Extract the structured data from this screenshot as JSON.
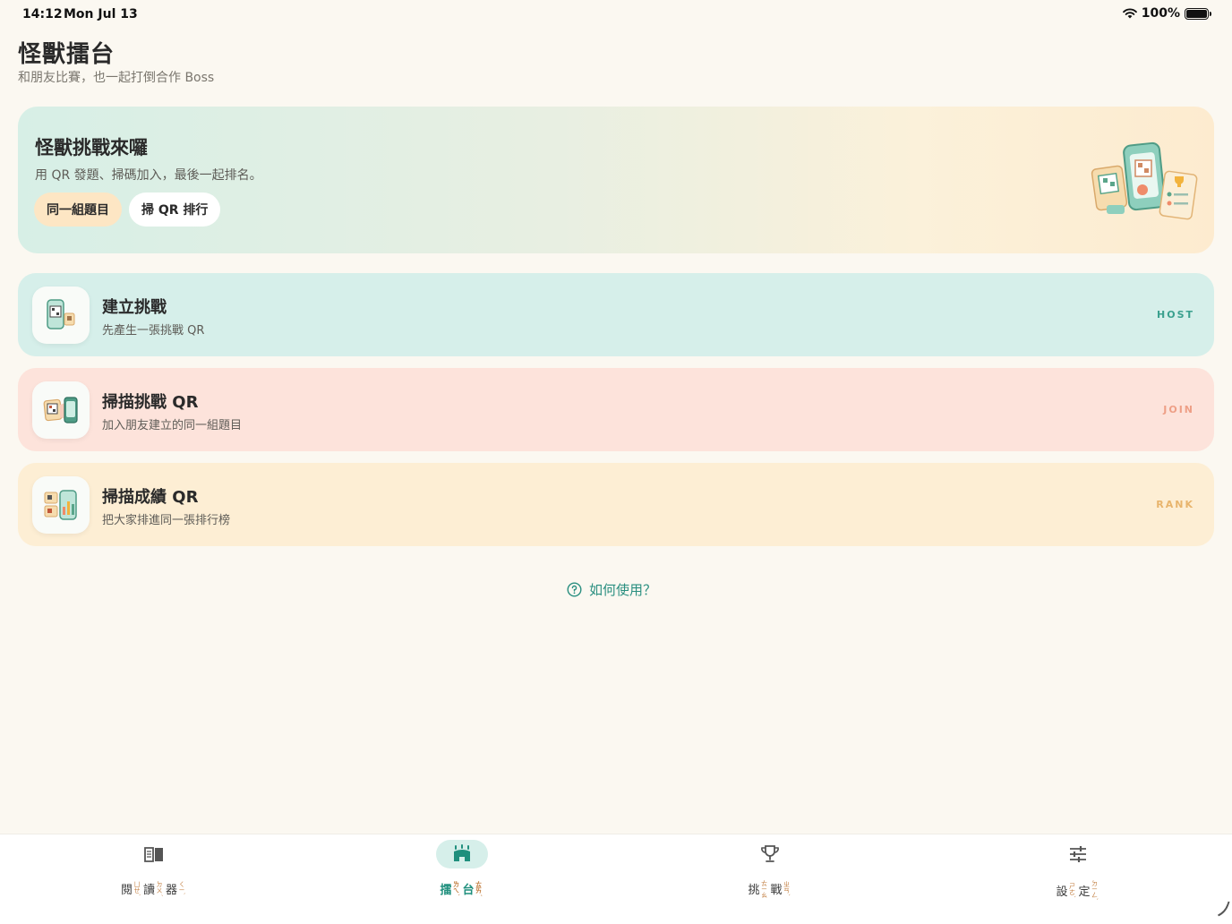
{
  "status_bar": {
    "time": "14:12",
    "date": "Mon Jul 13",
    "battery_percent": "100%",
    "battery_level": 1.0
  },
  "header": {
    "title": "怪獸擂台",
    "subtitle": "和朋友比賽，也一起打倒合作 Boss"
  },
  "hero": {
    "title": "怪獸挑戰來囉",
    "description": "用 QR 發題、掃碼加入，最後一起排名。",
    "chips": [
      {
        "label": "同一組題目"
      },
      {
        "label": "掃 QR 排行"
      }
    ]
  },
  "cards": {
    "host": {
      "title": "建立挑戰",
      "desc": "先產生一張挑戰 QR",
      "tag": "HOST",
      "color": "#d6efea"
    },
    "join": {
      "title": "掃描挑戰 QR",
      "desc": "加入朋友建立的同一組題目",
      "tag": "JOIN",
      "color": "#fde3db"
    },
    "rank": {
      "title": "掃描成績 QR",
      "desc": "把大家排進同一張排行榜",
      "tag": "RANK",
      "color": "#fdeed4"
    }
  },
  "help": {
    "label": "如何使用？",
    "icon": "question-circle-icon"
  },
  "tabs": [
    {
      "label_chars": [
        "閱",
        "讀",
        "器"
      ],
      "zhuyin": [
        "ㄩㄝˋ",
        "ㄉㄨˊ",
        "ㄑㄧˋ"
      ],
      "icon": "book-icon",
      "active": false
    },
    {
      "label_chars": [
        "擂",
        "台"
      ],
      "zhuyin": [
        "ㄌㄟˋ",
        "ㄊㄞˊ"
      ],
      "icon": "arena-icon",
      "active": true
    },
    {
      "label_chars": [
        "挑",
        "戰"
      ],
      "zhuyin": [
        "ㄊㄧㄠ",
        "ㄓㄢˋ"
      ],
      "icon": "trophy-icon",
      "active": false
    },
    {
      "label_chars": [
        "設",
        "定"
      ],
      "zhuyin": [
        "ㄕㄜˋ",
        "ㄉㄧㄥˋ"
      ],
      "icon": "sliders-icon",
      "active": false
    }
  ],
  "colors": {
    "accent": "#1f8f7d",
    "background": "#fbf8f1"
  }
}
